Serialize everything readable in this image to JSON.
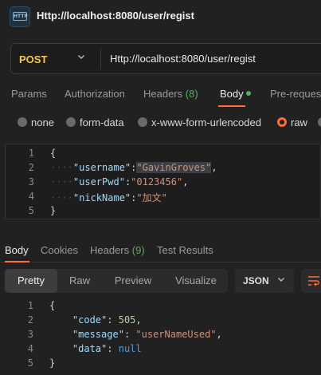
{
  "window": {
    "title": "Http://localhost:8080/user/regist",
    "icon": "http-file-icon",
    "icon_text": "HTTP"
  },
  "request": {
    "method": "POST",
    "url": "Http://localhost:8080/user/regist",
    "tabs": {
      "params": "Params",
      "authorization": "Authorization",
      "headers": "Headers",
      "headers_count": "(8)",
      "body": "Body",
      "prerequest": "Pre-reques"
    },
    "body_types": {
      "none": "none",
      "form_data": "form-data",
      "urlencoded": "x-www-form-urlencoded",
      "raw": "raw",
      "selected": "raw"
    },
    "editor": {
      "line_numbers": [
        "1",
        "2",
        "3",
        "4",
        "5"
      ],
      "open_brace": "{",
      "close_brace": "}",
      "rows": [
        {
          "key": "\"username\"",
          "value": "\"GavinGroves\"",
          "sep": ":",
          "trail": ","
        },
        {
          "key": "\"userPwd\"",
          "value": "\"0123456\"",
          "sep": ":",
          "trail": ","
        },
        {
          "key": "\"nickName\"",
          "value": "\"加文\"",
          "sep": ":",
          "trail": ""
        }
      ]
    }
  },
  "response": {
    "tabs": {
      "body": "Body",
      "cookies": "Cookies",
      "headers": "Headers",
      "headers_count": "(9)",
      "test_results": "Test Results"
    },
    "views": {
      "pretty": "Pretty",
      "raw": "Raw",
      "preview": "Preview",
      "visualize": "Visualize",
      "selected": "Pretty"
    },
    "format": "JSON",
    "editor": {
      "line_numbers": [
        "1",
        "2",
        "3",
        "4",
        "5"
      ],
      "open_brace": "{",
      "close_brace": "}",
      "rows": [
        {
          "key": "\"code\"",
          "sep": ": ",
          "value": "505",
          "trail": ","
        },
        {
          "key": "\"message\"",
          "sep": ": ",
          "value": "\"userNameUsed\"",
          "trail": ","
        },
        {
          "key": "\"data\"",
          "sep": ": ",
          "value": "null",
          "trail": ""
        }
      ]
    }
  },
  "colors": {
    "accent": "#ff6c37",
    "method": "#f2c94c",
    "success": "#4ab35b"
  }
}
